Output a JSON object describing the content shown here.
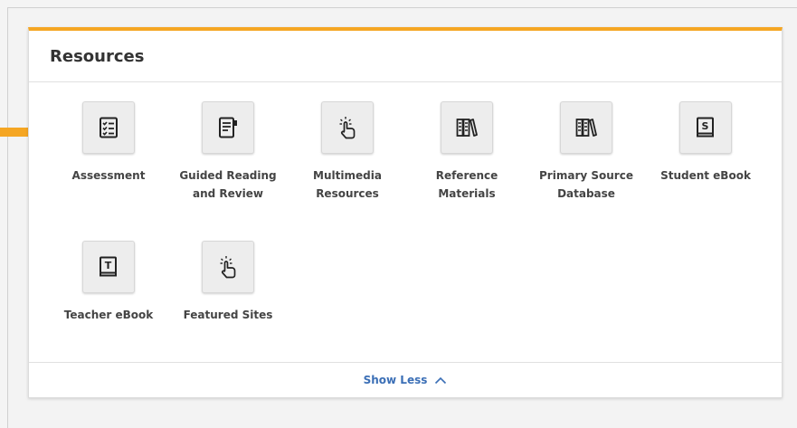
{
  "panel": {
    "title": "Resources",
    "accent_color": "#f5a623"
  },
  "resources": [
    {
      "label_line1": "Assessment",
      "label_line2": "",
      "icon": "checklist-icon"
    },
    {
      "label_line1": "Guided Reading",
      "label_line2": "and Review",
      "icon": "notebook-icon"
    },
    {
      "label_line1": "Multimedia",
      "label_line2": "Resources",
      "icon": "tap-hand-icon"
    },
    {
      "label_line1": "Reference",
      "label_line2": "Materials",
      "icon": "books-icon"
    },
    {
      "label_line1": "Primary Source",
      "label_line2": "Database",
      "icon": "books-icon"
    },
    {
      "label_line1": "Student eBook",
      "label_line2": "",
      "icon": "student-ebook-icon"
    },
    {
      "label_line1": "Teacher eBook",
      "label_line2": "",
      "icon": "teacher-ebook-icon"
    },
    {
      "label_line1": "Featured Sites",
      "label_line2": "",
      "icon": "tap-hand-icon"
    }
  ],
  "footer": {
    "show_less_label": "Show Less",
    "link_color": "#3b6fb6"
  },
  "annotation": {
    "arrow_color": "#f5a623"
  }
}
